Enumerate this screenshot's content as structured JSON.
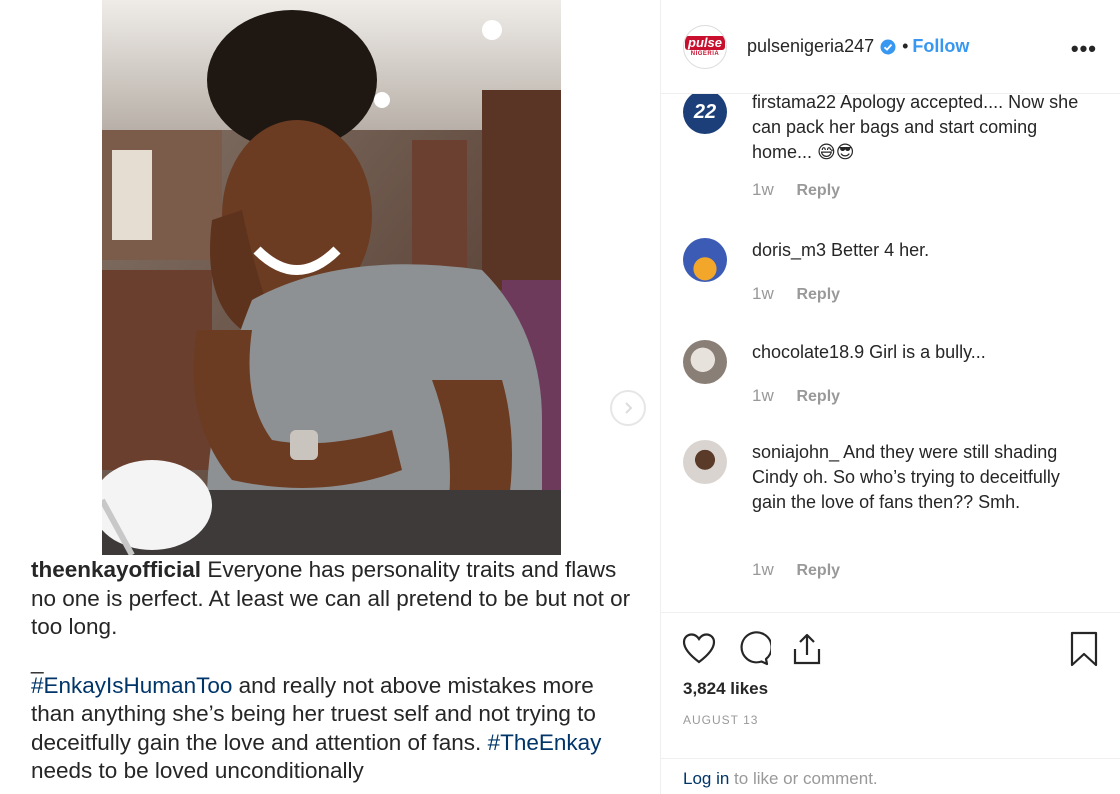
{
  "post": {
    "caption": {
      "username": "theenkayofficial",
      "text": "Everyone has personality traits and flaws no one is perfect. At least we can all pretend to be but not or too long.",
      "dash": "_",
      "hashtag1": "#EnkayIsHumanToo",
      "text2": "and really not above mistakes more than anything she’s being her truest self and not trying to deceitfully gain the love and attention of fans.",
      "hashtag2": "#TheEnkay",
      "text3": "needs to be loved unconditionally"
    }
  },
  "header": {
    "logo_text": "pulse",
    "logo_subtext": "NIGERIA",
    "username": "pulsenigeria247",
    "separator": "•",
    "follow_label": "Follow",
    "more_label": "•••"
  },
  "comments": [
    {
      "avatar_text": "22",
      "username": "firstama22",
      "text": "Apology accepted.... Now she can pack her bags and start coming home... 😅😎",
      "age": "1w",
      "reply": "Reply"
    },
    {
      "username": "doris_m3",
      "text": "Better 4 her.",
      "age": "1w",
      "reply": "Reply"
    },
    {
      "username": "chocolate18.9",
      "text": "Girl is a bully...",
      "age": "1w",
      "reply": "Reply"
    },
    {
      "username": "soniajohn_",
      "text": " And they were still shading Cindy oh. So who’s trying to deceitfully gain the love of fans then?? Smh.",
      "age": "1w",
      "reply": "Reply"
    }
  ],
  "actions": {
    "likes": "3,824 likes",
    "date": "AUGUST 13"
  },
  "login": {
    "link": "Log in",
    "text": " to like or comment."
  },
  "colors": {
    "accent": "#3897f0",
    "hashtag": "#003569",
    "muted": "#999999",
    "text": "#262626"
  }
}
